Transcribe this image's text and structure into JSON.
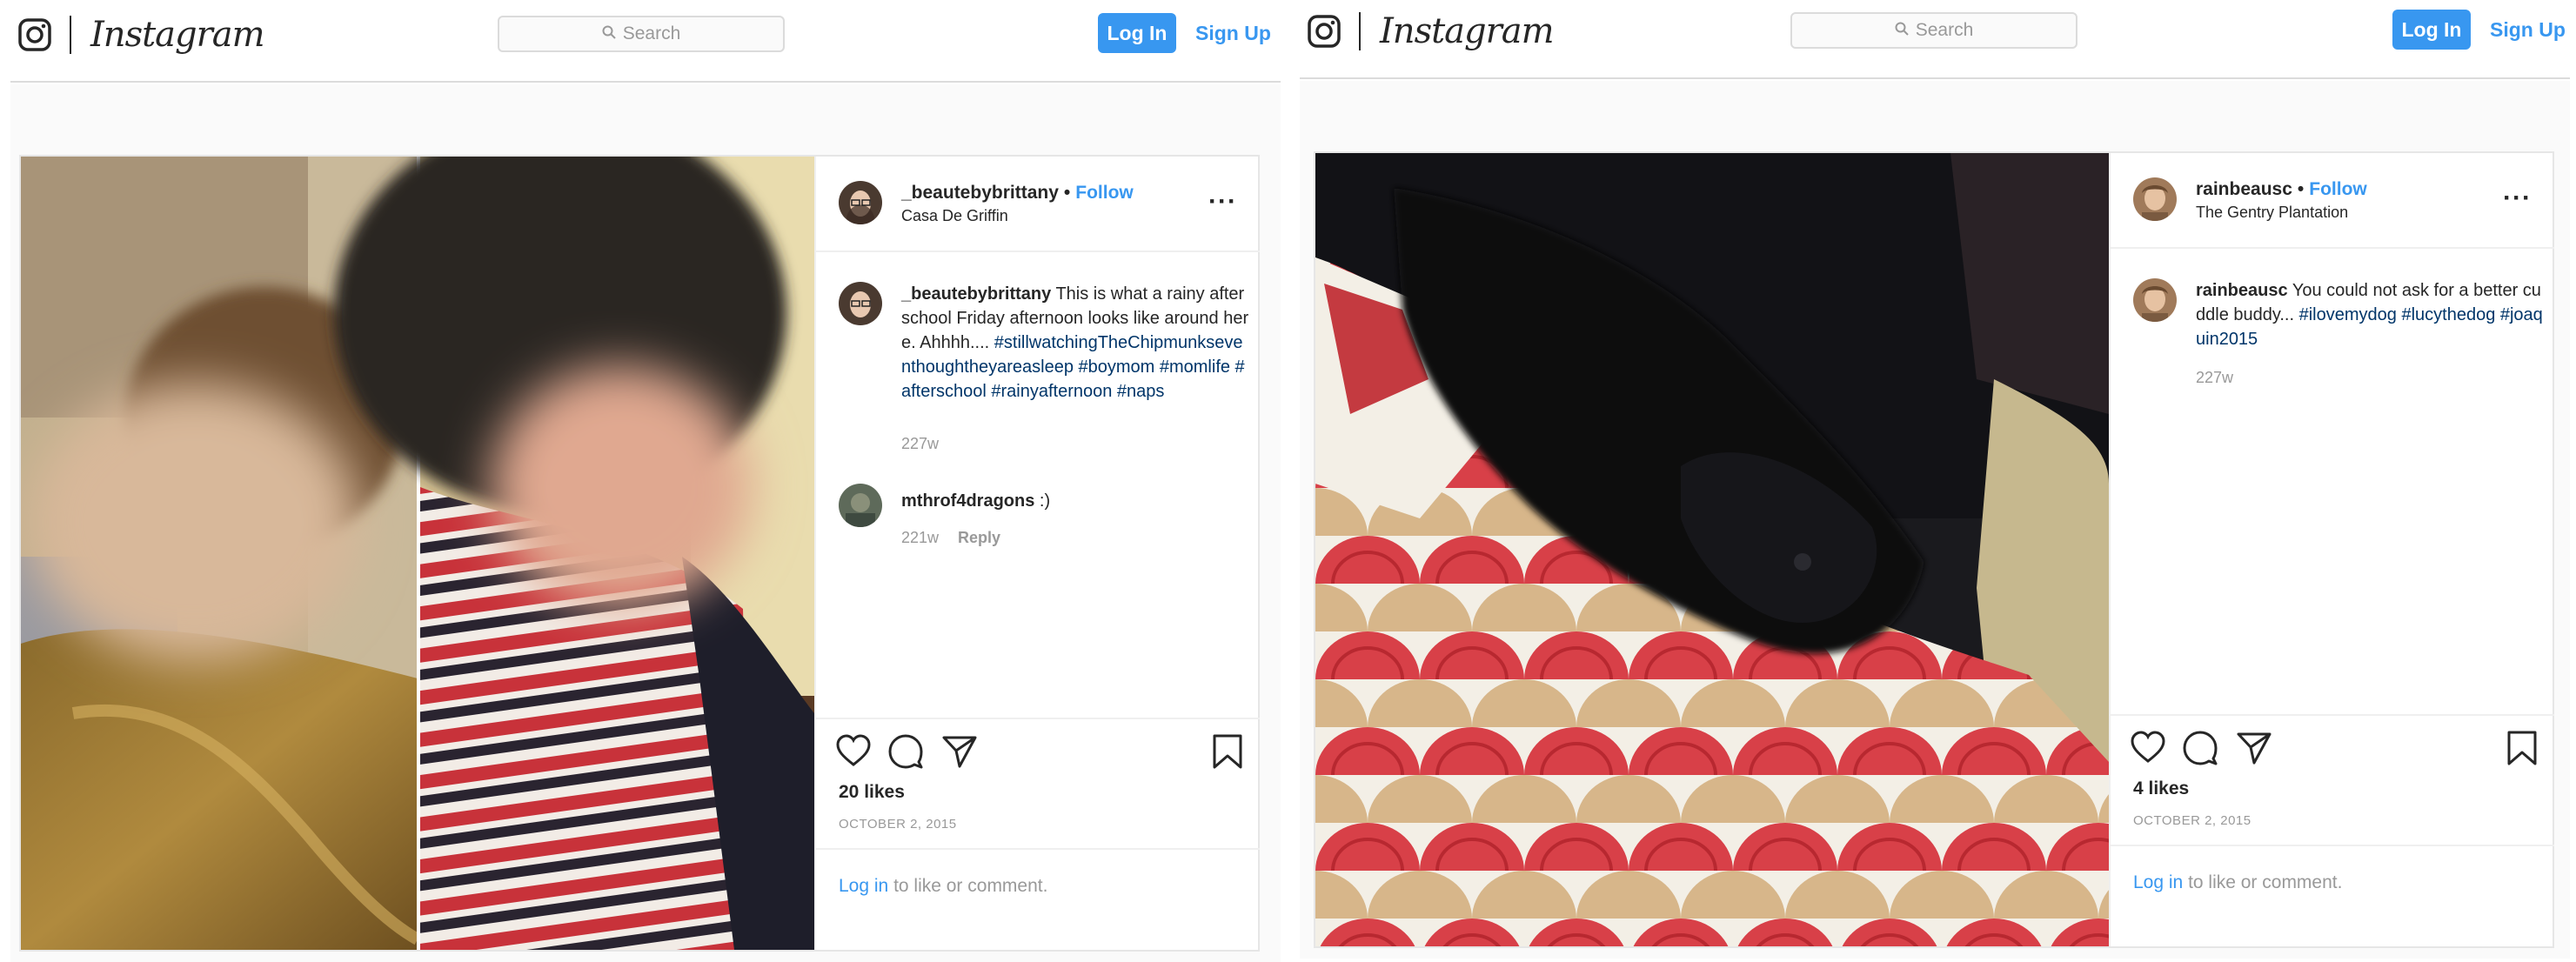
{
  "panes": [
    {
      "header": {
        "brand": "Instagram",
        "search_placeholder": "Search",
        "login_label": "Log In",
        "signup_label": "Sign Up"
      },
      "post": {
        "username": "_beautebybrittany",
        "follow_label": "Follow",
        "location": "Casa De Griffin",
        "caption_user": "_beautebybrittany",
        "caption_text": "This is what a rainy afterschool Friday afternoon looks like around here. Ahhhh....",
        "caption_tags": "#stillwatchingTheChipmunkseventhoughtheyareasleep #boymom #momlife #afterschool #rainyafternoon #naps",
        "caption_age": "227w",
        "comment_user": "mthrof4dragons",
        "comment_text": ":)",
        "comment_age": "221w",
        "reply_label": "Reply",
        "likes": "20 likes",
        "date": "OCTOBER 2, 2015",
        "login_link": "Log in",
        "login_rest": "to like or comment."
      }
    },
    {
      "header": {
        "brand": "Instagram",
        "search_placeholder": "Search",
        "login_label": "Log In",
        "signup_label": "Sign Up"
      },
      "post": {
        "username": "rainbeausc",
        "follow_label": "Follow",
        "location": "The Gentry Plantation",
        "caption_user": "rainbeausc",
        "caption_text": "You could not ask for a better cuddle buddy...",
        "caption_tags": "#ilovemydog #lucythedog #joaquin2015",
        "caption_age": "227w",
        "likes": "4 likes",
        "date": "OCTOBER 2, 2015",
        "login_link": "Log in",
        "login_rest": "to like or comment."
      }
    }
  ],
  "icons": {
    "camera": "instagram-glyph-icon",
    "search": "search-icon",
    "more": "more-options-icon",
    "like": "heart-icon",
    "comment": "comment-icon",
    "share": "share-icon",
    "save": "bookmark-icon"
  },
  "colors": {
    "accent": "#3897f0",
    "hashtag": "#003569",
    "border": "#dbdbdb",
    "muted": "#999999"
  }
}
